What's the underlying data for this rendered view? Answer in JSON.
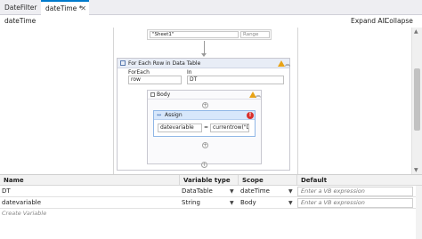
{
  "tabs": [
    {
      "label": "DateFilter"
    },
    {
      "label": "dateTime *"
    }
  ],
  "breadcrumb": "dateTime",
  "toolbar": {
    "expand_all": "Expand All",
    "collapse_all": "Collapse All"
  },
  "designer": {
    "read_range": {
      "sheet_value": "\"Sheet1\"",
      "range_placeholder": "Range"
    },
    "for_each": {
      "title": "For Each Row in Data Table",
      "foreach_label": "ForEach",
      "foreach_value": "row",
      "in_label": "In",
      "in_value": "DT"
    },
    "body": {
      "title": "Body"
    },
    "assign": {
      "title": "Assign",
      "to_value": "datevariable",
      "value_expression": "currentrow(\"Da"
    }
  },
  "variables": {
    "headers": {
      "name": "Name",
      "type": "Variable type",
      "scope": "Scope",
      "default": "Default"
    },
    "rows": [
      {
        "name": "DT",
        "type": "DataTable",
        "scope": "dateTime",
        "default": "Enter a VB expression"
      },
      {
        "name": "datevariable",
        "type": "String",
        "scope": "Body",
        "default": "Enter a VB expression"
      }
    ],
    "create_label": "Create Variable"
  },
  "colors": {
    "accent": "#007acc",
    "warning": "#e8a317",
    "error": "#d9302c",
    "activity_header": "#d7e7fb"
  }
}
